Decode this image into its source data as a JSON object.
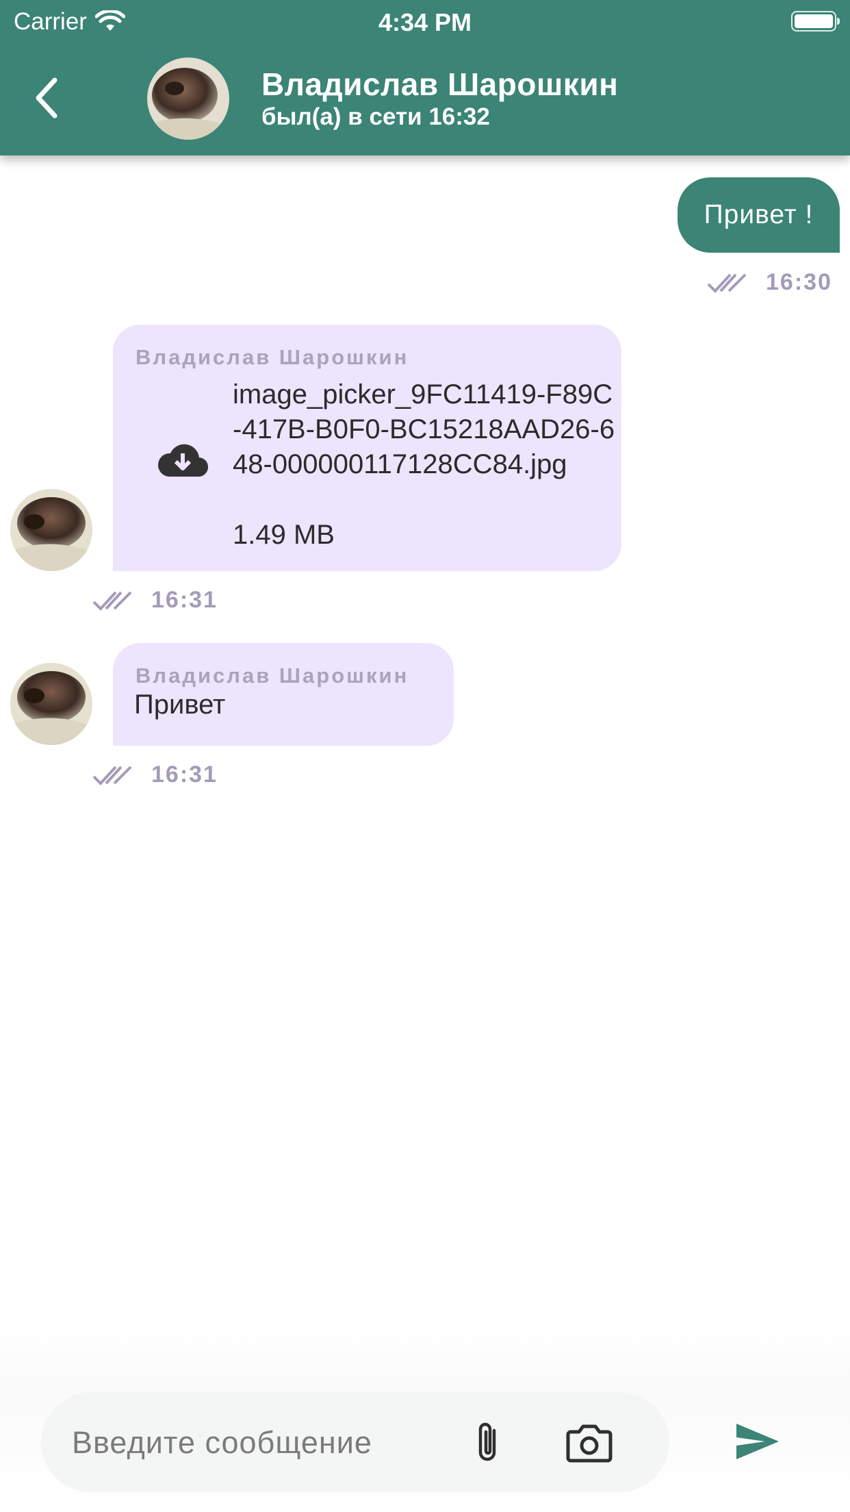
{
  "status_bar": {
    "carrier": "Carrier",
    "time": "4:34 PM"
  },
  "header": {
    "contact_name": "Владислав Шарошкин",
    "last_seen": "был(а) в сети 16:32"
  },
  "messages": {
    "outgoing_1": {
      "text": "Привет !",
      "time": "16:30"
    },
    "incoming_file": {
      "sender": "Владислав Шарошкин",
      "file_name": "image_picker_9FC11419-F89C-417B-B0F0-BC15218AAD26-648-000000117128CC84.jpg",
      "file_size": "1.49 MB",
      "time": "16:31"
    },
    "incoming_text": {
      "sender": "Владислав Шарошкин",
      "text": "Привет",
      "time": "16:31"
    }
  },
  "composer": {
    "placeholder": "Введите сообщение"
  },
  "colors": {
    "primary": "#3b8476",
    "incoming_bubble": "#ede4fd",
    "meta_text": "#a39bb8"
  },
  "icons": {
    "back": "chevron-left-icon",
    "download": "cloud-download-icon",
    "attach": "paperclip-icon",
    "camera": "camera-icon",
    "send": "send-icon",
    "read": "double-check-icon"
  }
}
